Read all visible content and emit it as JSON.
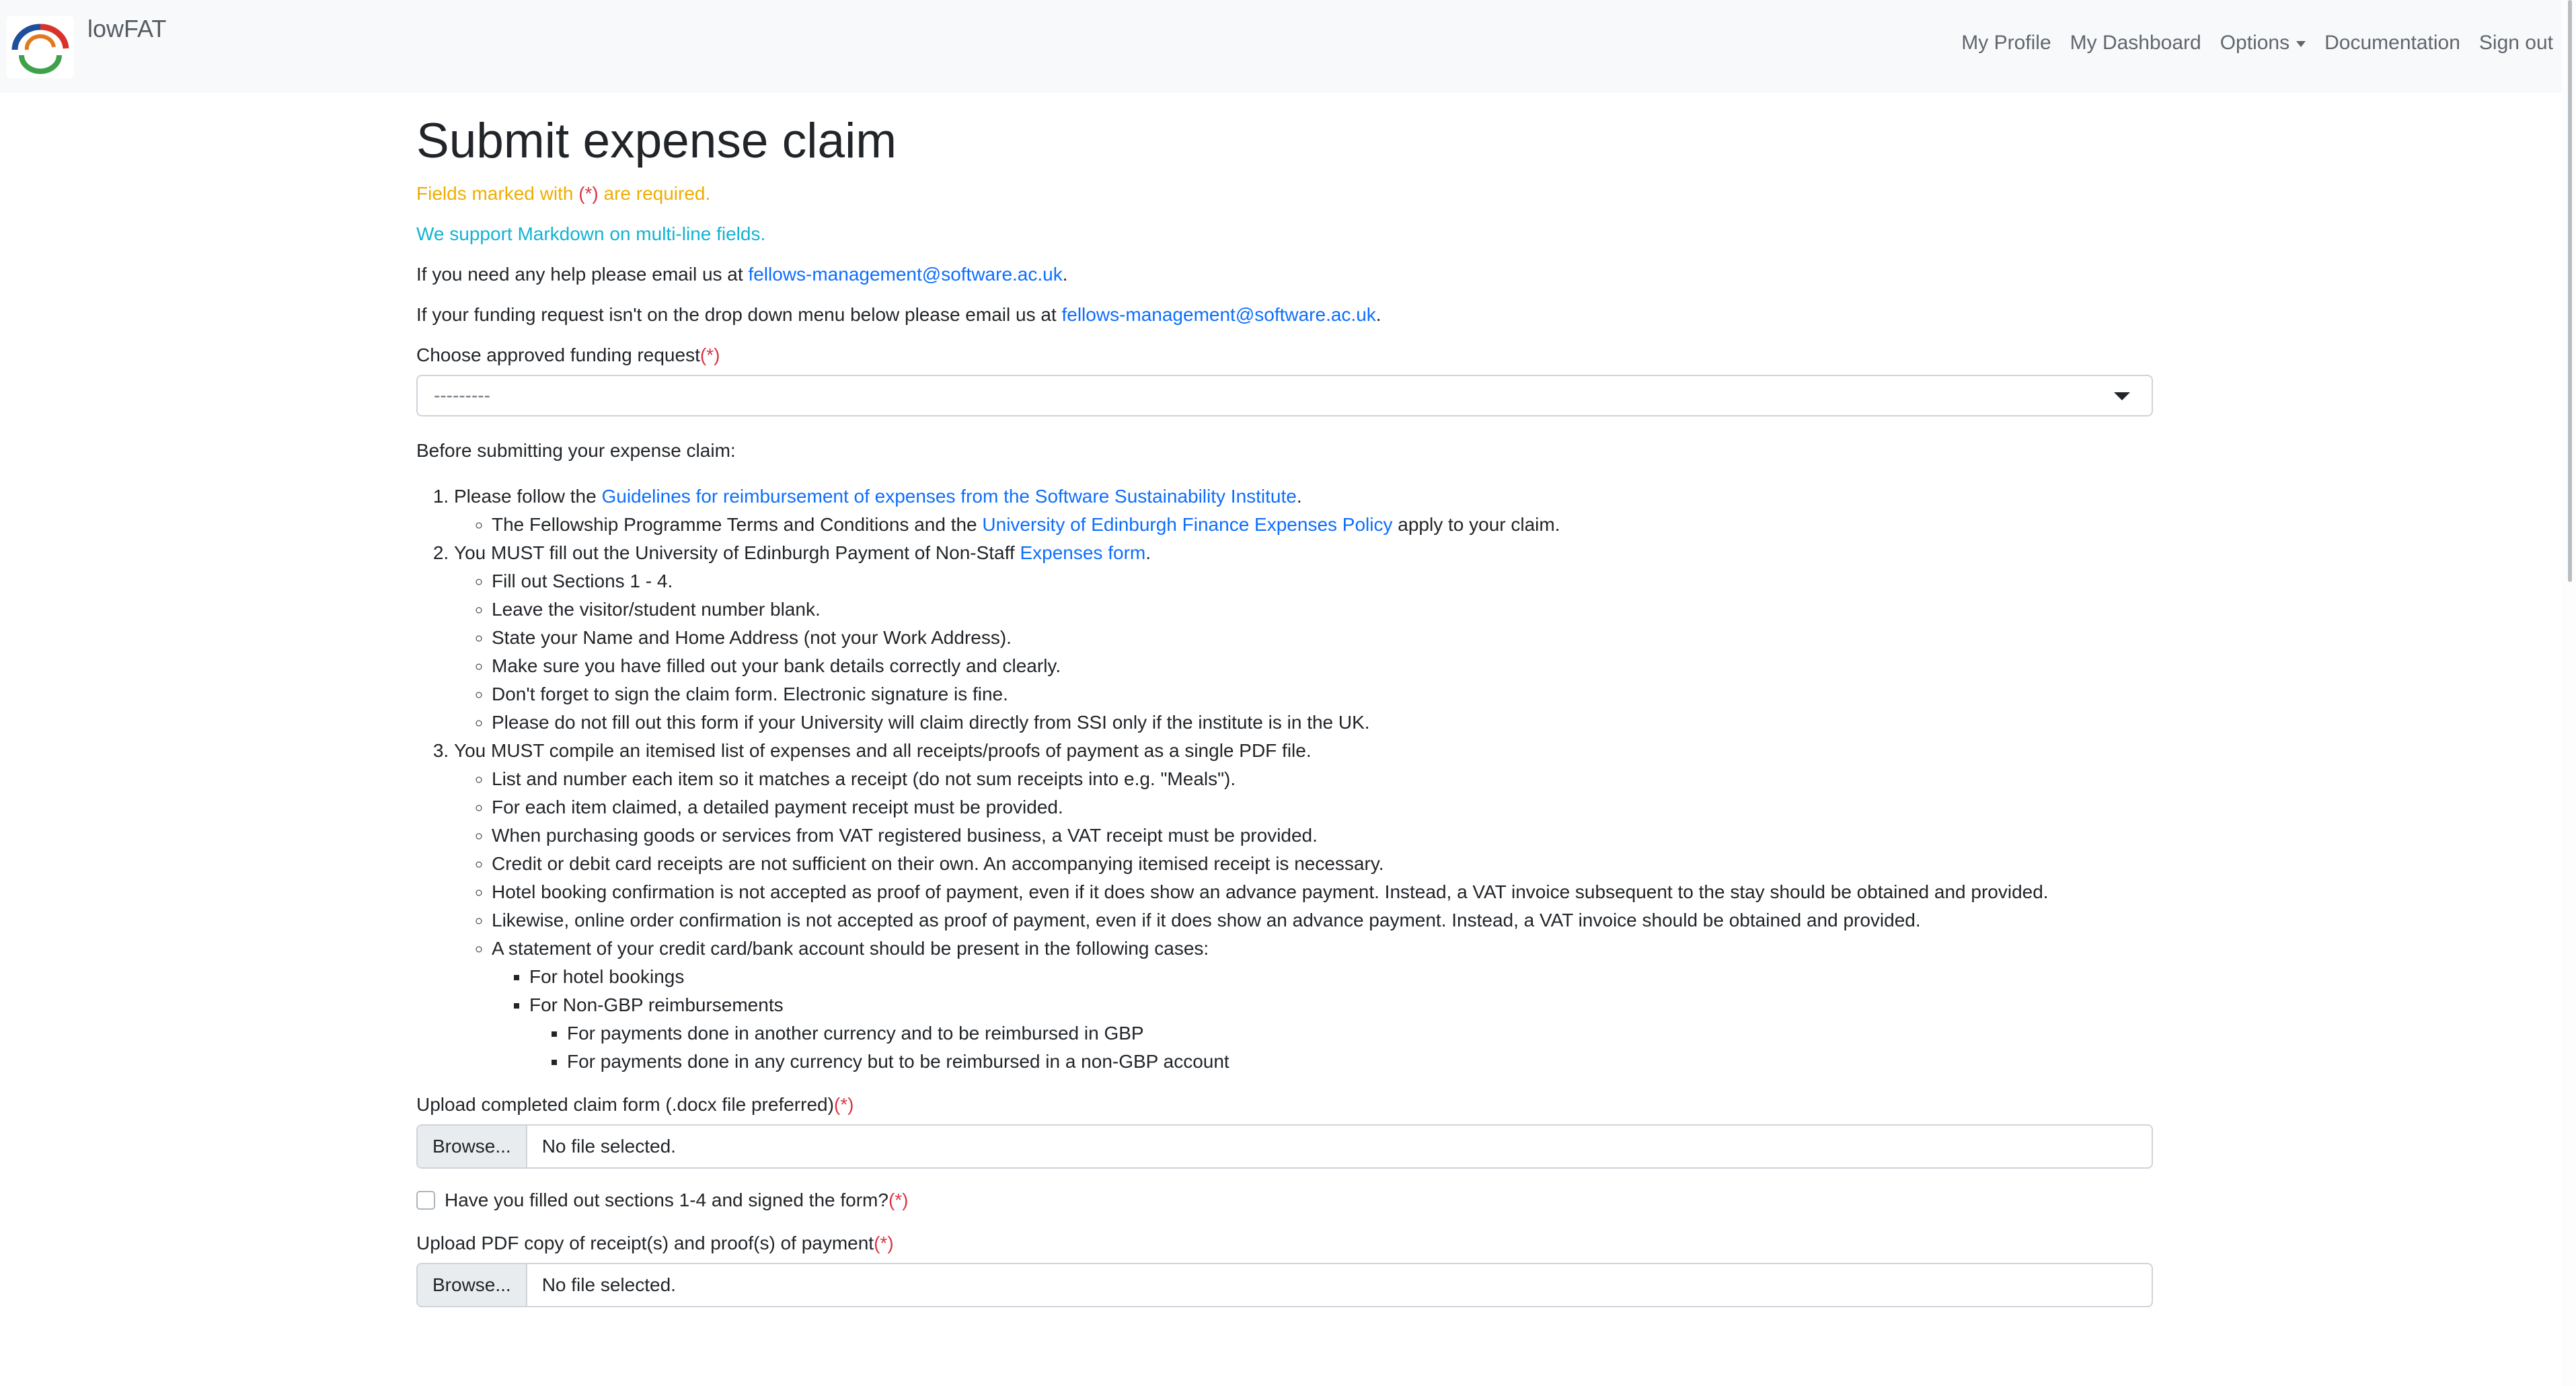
{
  "navbar": {
    "brand": "lowFAT",
    "links": {
      "profile": "My Profile",
      "dashboard": "My Dashboard",
      "options": "Options",
      "documentation": "Documentation",
      "signout": "Sign out"
    }
  },
  "page": {
    "title": "Submit expense claim",
    "required_note_pre": "Fields marked with ",
    "required_marker": "(*)",
    "required_note_post": " are required.",
    "markdown_note": "We support Markdown on multi-line fields.",
    "help_pre": "If you need any help please email us at ",
    "help_email": "fellows-management@software.ac.uk",
    "help_post": ".",
    "funding_pre": "If your funding request isn't on the drop down menu below please email us at ",
    "funding_email": "fellows-management@software.ac.uk",
    "funding_post": "."
  },
  "form": {
    "funding_label": "Choose approved funding request",
    "required_marker": "(*)",
    "funding_selected": "---------",
    "before_heading": "Before submitting your expense claim:",
    "claim_form_label": "Upload completed claim form (.docx file preferred)",
    "browse_label": "Browse...",
    "no_file": "No file selected.",
    "checkbox_label": "Have you filled out sections 1-4 and signed the form?",
    "receipt_label": "Upload PDF copy of receipt(s) and proof(s) of payment"
  },
  "instructions": {
    "item1_pre": "Please follow the ",
    "item1_link": "Guidelines for reimbursement of expenses from the Software Sustainability Institute",
    "item1_post": ".",
    "item1_sub_pre": "The Fellowship Programme Terms and Conditions and the ",
    "item1_sub_link": "University of Edinburgh Finance Expenses Policy",
    "item1_sub_post": " apply to your claim.",
    "item2_pre": "You MUST fill out the University of Edinburgh Payment of Non-Staff ",
    "item2_link": "Expenses form",
    "item2_post": ".",
    "item2_subs": [
      "Fill out Sections 1 - 4.",
      "Leave the visitor/student number blank.",
      "State your Name and Home Address (not your Work Address).",
      "Make sure you have filled out your bank details correctly and clearly.",
      "Don't forget to sign the claim form. Electronic signature is fine.",
      "Please do not fill out this form if your University will claim directly from SSI only if the institute is in the UK."
    ],
    "item3": "You MUST compile an itemised list of expenses and all receipts/proofs of payment as a single PDF file.",
    "item3_subs": [
      "List and number each item so it matches a receipt (do not sum receipts into e.g. \"Meals\").",
      "For each item claimed, a detailed payment receipt must be provided.",
      "When purchasing goods or services from VAT registered business, a VAT receipt must be provided.",
      "Credit or debit card receipts are not sufficient on their own. An accompanying itemised receipt is necessary.",
      "Hotel booking confirmation is not accepted as proof of payment, even if it does show an advance payment. Instead, a VAT invoice subsequent to the stay should be obtained and provided.",
      "Likewise, online order confirmation is not accepted as proof of payment, even if it does show an advance payment. Instead, a VAT invoice should be obtained and provided.",
      "A statement of your credit card/bank account should be present in the following cases:"
    ],
    "statement_cases": [
      "For hotel bookings",
      "For Non-GBP reimbursements"
    ],
    "non_gbp_cases": [
      "For payments done in another currency and to be reimbursed in GBP",
      "For payments done in any currency but to be reimbursed in a non-GBP account"
    ]
  }
}
